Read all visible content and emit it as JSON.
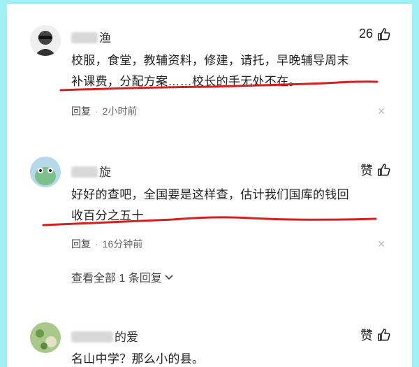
{
  "comments": [
    {
      "username": "渔",
      "likes": "26",
      "text_lines": [
        "校服，食堂，教辅资料，修建，请托，早晚辅导周末",
        "补课费，分配方案……校长的手无处不在。"
      ],
      "reply_label": "回复",
      "time": "2小时前"
    },
    {
      "username": "旋",
      "likes": "赞",
      "text_lines": [
        "好好的查吧，全国要是这样查，估计我们国库的钱回",
        "收百分之五十"
      ],
      "reply_label": "回复",
      "time": "16分钟前"
    },
    {
      "username": "的爱",
      "likes": "赞",
      "text_lines": [
        "名山中学？那么小的县。"
      ]
    }
  ],
  "view_all_replies": "查看全部 1 条回复",
  "colors": {
    "background": "#9ff0f4",
    "underline": "#d81e1e"
  }
}
